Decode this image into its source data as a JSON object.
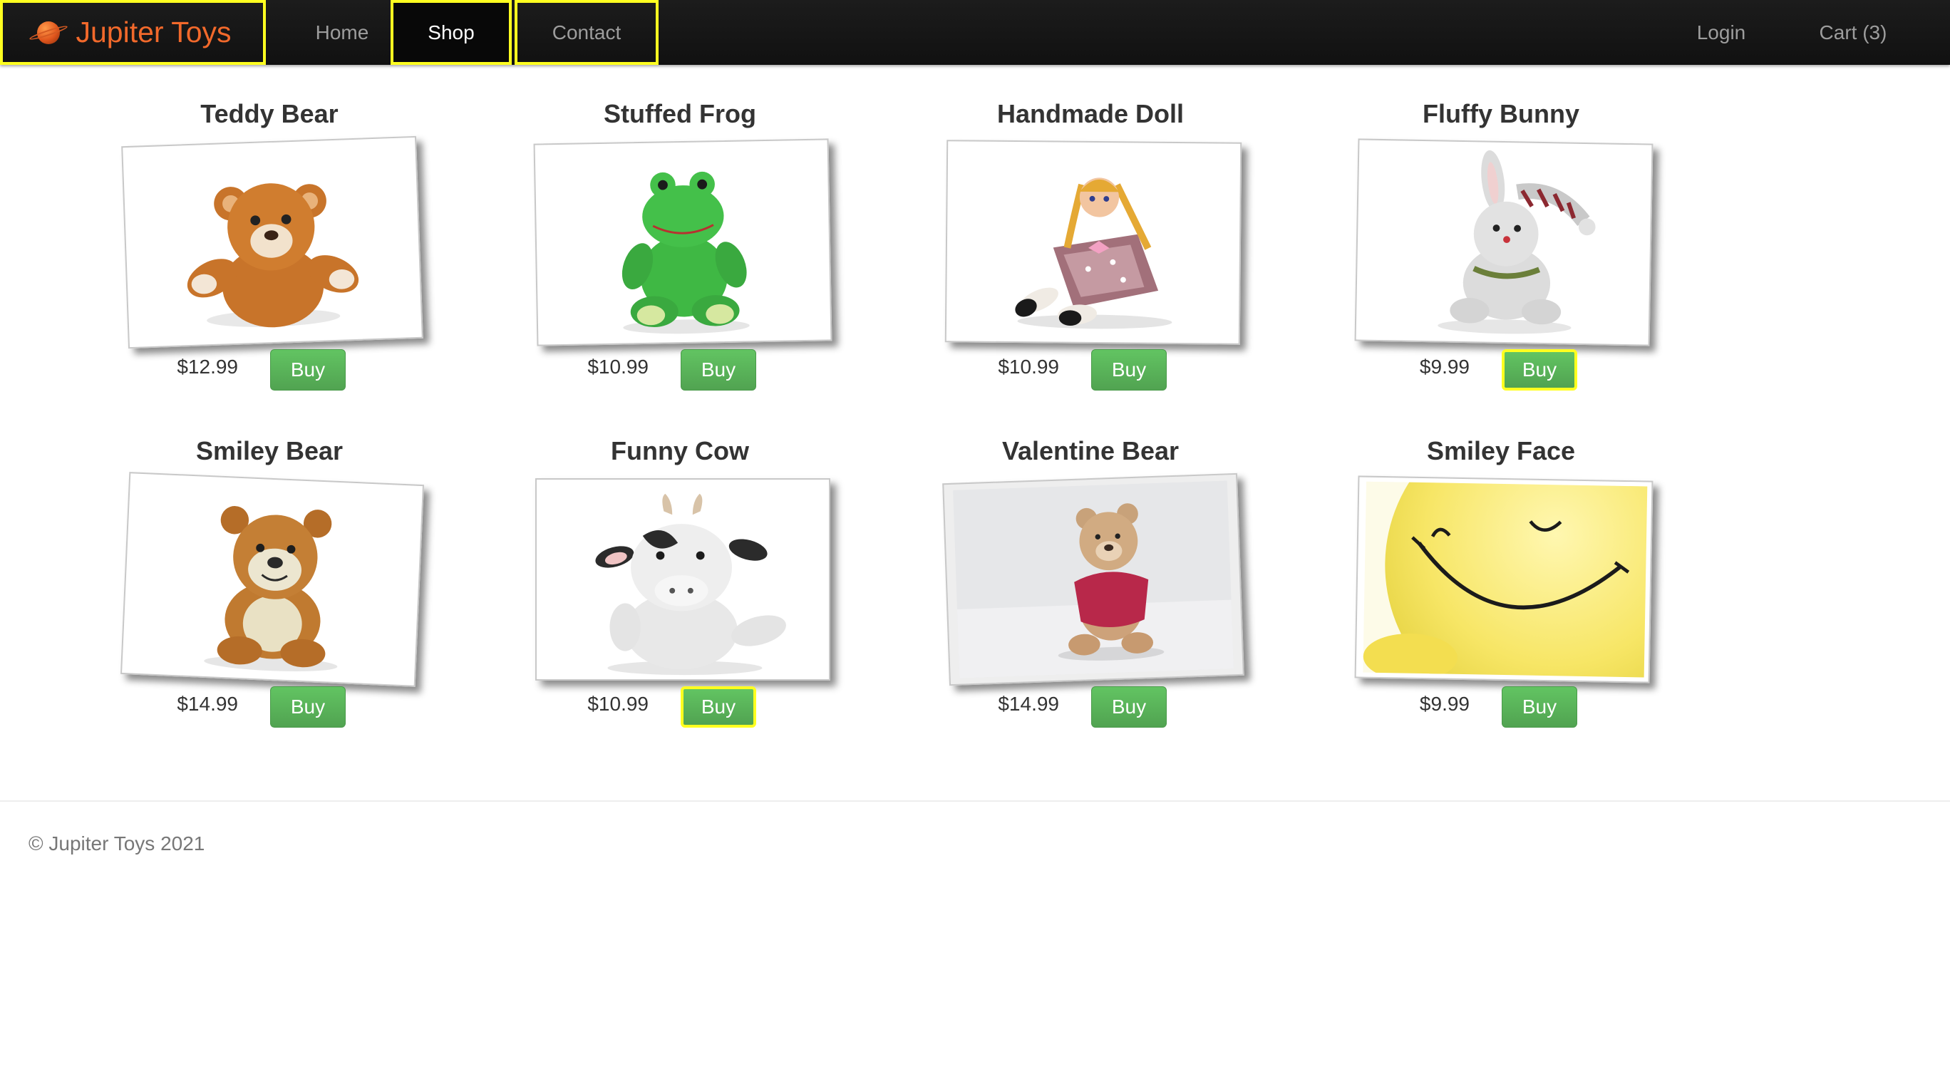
{
  "navbar": {
    "brand": "Jupiter Toys",
    "home": "Home",
    "shop": "Shop",
    "contact": "Contact",
    "login": "Login",
    "cart": "Cart (3)"
  },
  "products": [
    {
      "title": "Teddy Bear",
      "price": "$12.99",
      "buy": "Buy"
    },
    {
      "title": "Stuffed Frog",
      "price": "$10.99",
      "buy": "Buy"
    },
    {
      "title": "Handmade Doll",
      "price": "$10.99",
      "buy": "Buy"
    },
    {
      "title": "Fluffy Bunny",
      "price": "$9.99",
      "buy": "Buy"
    },
    {
      "title": "Smiley Bear",
      "price": "$14.99",
      "buy": "Buy"
    },
    {
      "title": "Funny Cow",
      "price": "$10.99",
      "buy": "Buy"
    },
    {
      "title": "Valentine Bear",
      "price": "$14.99",
      "buy": "Buy"
    },
    {
      "title": "Smiley Face",
      "price": "$9.99",
      "buy": "Buy"
    }
  ],
  "footer": {
    "copyright": "© Jupiter Toys 2021"
  },
  "colors": {
    "navbar": "#1a1a1a",
    "brand": "#f2692b",
    "buy_button": "#5cb85c",
    "highlight": "#ffff20"
  }
}
